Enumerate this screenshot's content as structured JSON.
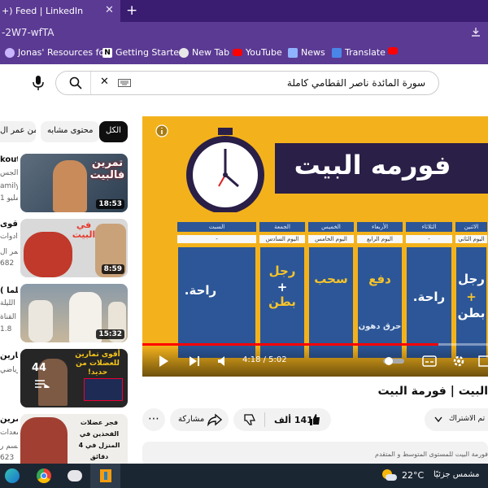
{
  "browser": {
    "tab_title": "+) Feed | LinkedIn",
    "tab_close": "✕",
    "new_tab": "+",
    "address": "-2W7-wfTA",
    "bookmarks": [
      {
        "label": "Jonas' Resources fo...",
        "icon": "heart-icon",
        "color": "#c9b6ff"
      },
      {
        "label": "Getting Started",
        "icon": "notion-icon",
        "color": "#ffffff"
      },
      {
        "label": "New Tab",
        "icon": "edge-icon",
        "color": "#e8e8e8"
      },
      {
        "label": "YouTube",
        "icon": "youtube-icon",
        "color": "#ff0000"
      },
      {
        "label": "News",
        "icon": "news-icon",
        "color": "#8fb3ff"
      },
      {
        "label": "Translate",
        "icon": "translate-icon",
        "color": "#4a86e8"
      },
      {
        "label": "",
        "icon": "youtube-icon",
        "color": "#ff0000"
      }
    ]
  },
  "search": {
    "query": "سورة المائدة ناصر القطامي كاملة",
    "clear": "✕"
  },
  "chips": {
    "all": "الكل",
    "related": "محتوى مشابه",
    "from_channel": "من عمر ال"
  },
  "side_partial": {
    "title1": "kout",
    "lines1": [
      "الجس",
      "amily",
      "1 مليو"
    ],
    "title2": "أقوى",
    "lines2": [
      "أدوات",
      "عمر ال",
      "682"
    ],
    "title3": "( فلما",
    "lines3": [
      "الليلة",
      "القناة",
      "1.8"
    ],
    "title4": "تمارين",
    "lines4": [
      "رياضي"
    ],
    "title5": "تمرين",
    "lines5": [
      "معدات",
      "جسم ر",
      "623"
    ]
  },
  "recommended": [
    {
      "duration": "18:53",
      "overlay": "تمرين فالبيت"
    },
    {
      "duration": "8:59",
      "overlay": "في البيت"
    },
    {
      "duration": "15:32",
      "overlay": ""
    },
    {
      "duration": "",
      "overlay": "أقوى تمارين للعضلات من حديد!",
      "count": "44"
    },
    {
      "duration": "",
      "overlay": "فجر عضلات الفخذين في المنزل في 4 دقائق"
    }
  ],
  "player": {
    "banner_title": "فورمه البيت",
    "time": "4:18 / 5:02",
    "progress": 0.856,
    "table_headers": [
      "الاثنين",
      "الثلاثاء",
      "الأربعاء",
      "الخميس",
      "الجمعة",
      "السبت"
    ],
    "table_days": [
      "اليوم الثاني",
      "-",
      "اليوم الرابع",
      "اليوم الخامس",
      "اليوم السادس",
      "-"
    ],
    "cells": [
      {
        "top": "رجل",
        "mid": "+",
        "bot": "بطن"
      },
      {
        "top": "راحة.",
        "mid": "",
        "bot": ""
      },
      {
        "top": "دفع",
        "mid": "",
        "bot": "حرق دهون"
      },
      {
        "top": "سحب",
        "mid": "",
        "bot": ""
      },
      {
        "top": "رجل",
        "mid": "+",
        "bot": "بطن"
      },
      {
        "top": "راحة.",
        "mid": "",
        "bot": ""
      }
    ]
  },
  "video": {
    "title": "البيت | فورمة البيت",
    "likes": "141 ألف",
    "share": "مشاركة",
    "subscribe": "تم الاشتراك",
    "more": "⋯",
    "description": "فورمة البيت للمستوى المتوسط و المتقدم"
  },
  "taskbar": {
    "temperature": "22°C",
    "weather": "مشمس جزئيًا"
  }
}
